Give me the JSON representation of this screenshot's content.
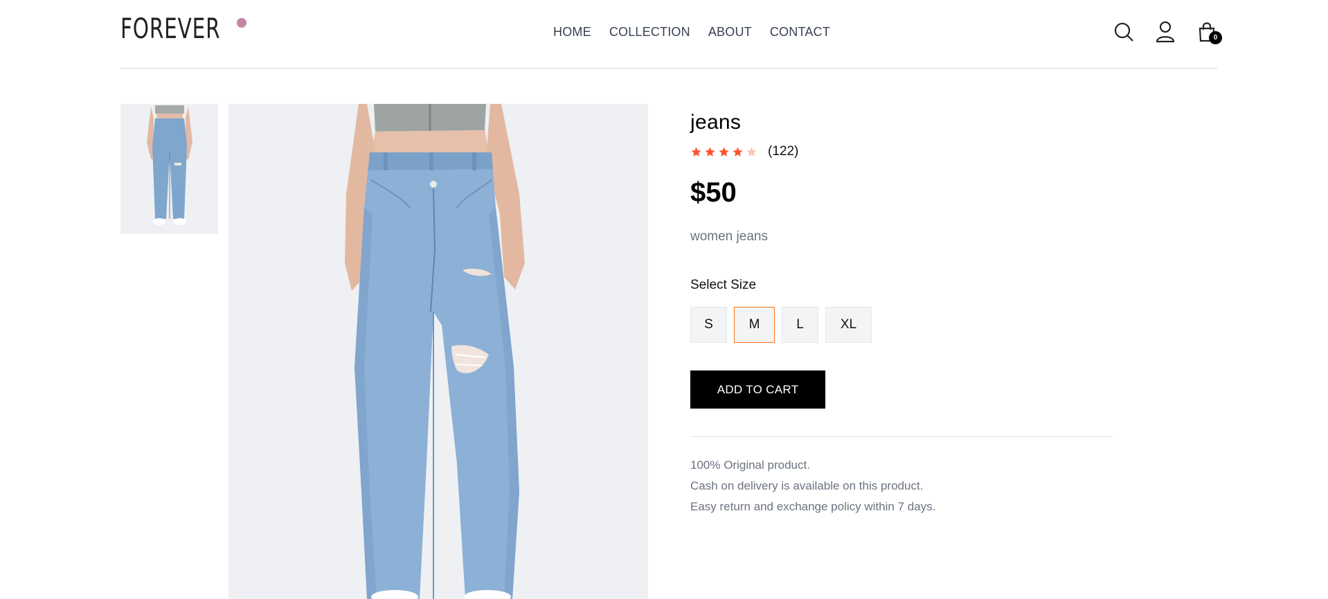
{
  "header": {
    "logo": "FOREVER",
    "nav": [
      "HOME",
      "COLLECTION",
      "ABOUT",
      "CONTACT"
    ],
    "cart_count": "0"
  },
  "product": {
    "title": "jeans",
    "rating": 4,
    "rating_max": 5,
    "reviews": "(122)",
    "price": "$50",
    "description": "women jeans",
    "size_label": "Select Size",
    "sizes": [
      "S",
      "M",
      "L",
      "XL"
    ],
    "selected_size": "M",
    "add_to_cart": "ADD TO CART",
    "policies": [
      "100% Original product.",
      "Cash on delivery is available on this product.",
      "Easy return and exchange policy within 7 days."
    ]
  },
  "colors": {
    "accent_star": "#ff532e",
    "selected_border": "#f97316",
    "logo_dot": "#c586a5",
    "button_bg": "#000000"
  },
  "icons": [
    "search-icon",
    "profile-icon",
    "cart-icon",
    "star-icon"
  ]
}
